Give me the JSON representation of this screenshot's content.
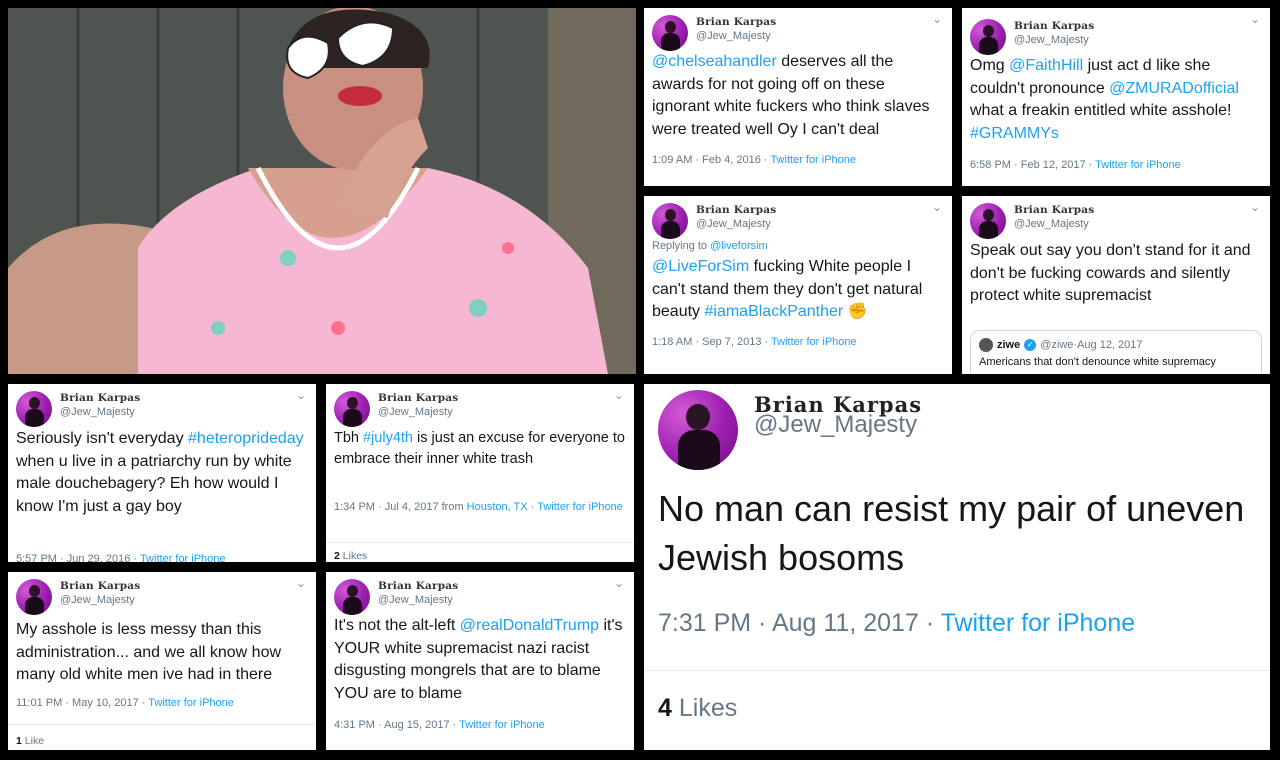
{
  "author": {
    "display_name": "Brian Karpas",
    "handle": "@Jew_Majesty"
  },
  "tweets": [
    {
      "id": "t1",
      "body_parts": [
        {
          "t": "@chelseahandler",
          "l": true
        },
        {
          "t": " deserves all the awards for not going off on these ignorant white fuckers who think slaves were treated well Oy I can't deal",
          "l": false
        }
      ],
      "timestamp": "1:09 AM · Feb 4, 2016",
      "source": "Twitter for iPhone"
    },
    {
      "id": "t2",
      "body_parts": [
        {
          "t": "Omg ",
          "l": false
        },
        {
          "t": "@FaithHill",
          "l": true
        },
        {
          "t": " just act d like she couldn't pronounce ",
          "l": false
        },
        {
          "t": "@ZMURADofficial",
          "l": true
        },
        {
          "t": " what a freakin entitled white asshole! ",
          "l": false
        },
        {
          "t": "#GRAMMYs",
          "l": true
        }
      ],
      "timestamp": "6:58 PM · Feb 12, 2017",
      "source": "Twitter for iPhone"
    },
    {
      "id": "t3",
      "replying_prefix": "Replying to ",
      "replying_to": "@liveforsim",
      "body_parts": [
        {
          "t": "@LiveForSim",
          "l": true
        },
        {
          "t": " fucking White people I can't stand them they don't get natural beauty ",
          "l": false
        },
        {
          "t": "#iamaBlackPanther",
          "l": true
        },
        {
          "t": " ✊",
          "l": false
        }
      ],
      "timestamp": "1:18 AM · Sep 7, 2013",
      "source": "Twitter for iPhone"
    },
    {
      "id": "t4",
      "body_parts": [
        {
          "t": "Speak out say you don't stand for it and don't be fucking cowards and silently protect white supremacist",
          "l": false
        }
      ],
      "quote": {
        "name": "ziwe",
        "handle": "@ziwe",
        "date": "Aug 12, 2017",
        "text": "Americans that don't denounce white supremacy"
      }
    },
    {
      "id": "t5",
      "body_parts": [
        {
          "t": "Seriously isn't everyday ",
          "l": false
        },
        {
          "t": "#heteroprideday",
          "l": true
        },
        {
          "t": " when u live in a patriarchy run by white male douchebagery? Eh how would I know I'm just a gay boy",
          "l": false
        }
      ],
      "timestamp": "5:57 PM · Jun 29, 2016",
      "source": "Twitter for iPhone"
    },
    {
      "id": "t6",
      "body_parts": [
        {
          "t": "Tbh ",
          "l": false
        },
        {
          "t": "#july4th",
          "l": true
        },
        {
          "t": " is just an excuse for everyone to embrace their inner white trash",
          "l": false
        }
      ],
      "timestamp": "1:34 PM · Jul 4, 2017 from ",
      "location": "Houston, TX",
      "source": "Twitter for iPhone",
      "likes_count": "2",
      "likes_label": "Likes"
    },
    {
      "id": "t7",
      "body_parts": [
        {
          "t": "My asshole is less messy than this administration... and we all know how many old white men ive had in there",
          "l": false
        }
      ],
      "timestamp": "11:01 PM · May 10, 2017",
      "source": "Twitter for iPhone",
      "likes_count": "1",
      "likes_label": "Like"
    },
    {
      "id": "t8",
      "body_parts": [
        {
          "t": "It's not the alt-left ",
          "l": false
        },
        {
          "t": "@realDonaldTrump",
          "l": true
        },
        {
          "t": " it's YOUR white supremacist nazi racist disgusting mongrels that are to blame YOU are to blame",
          "l": false
        }
      ],
      "timestamp": "4:31 PM · Aug 15, 2017",
      "source": "Twitter for iPhone"
    },
    {
      "id": "t9",
      "body_parts": [
        {
          "t": "No man can resist my pair of uneven Jewish bosoms",
          "l": false
        }
      ],
      "timestamp": "7:31 PM · Aug 11, 2017",
      "source": "Twitter for iPhone",
      "likes_count": "4",
      "likes_label": "Likes"
    }
  ],
  "separator": " · ",
  "colors": {
    "link": "#1da1f2",
    "text": "#14171a",
    "muted": "#657786",
    "avatar": "#9c1fb0",
    "dress": "#f6b7d2"
  },
  "icons": {
    "chevron": "chevron-down-icon",
    "verified": "verified-badge-icon"
  }
}
